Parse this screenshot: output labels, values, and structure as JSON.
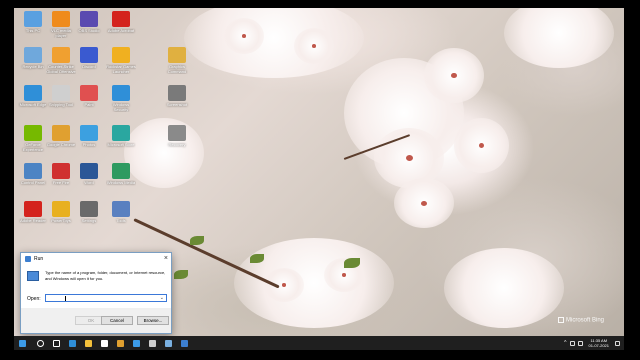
{
  "desktop": {
    "icons": [
      {
        "label": "This PC",
        "color": "#5aa0e0"
      },
      {
        "label": "Recycle Bin",
        "color": "#6fa8dc"
      },
      {
        "label": "Microsoft Edge",
        "color": "#2f8fd8"
      },
      {
        "label": "GeForce Experience",
        "color": "#76b900"
      },
      {
        "label": "Control Panel",
        "color": "#4c84c4"
      },
      {
        "label": "Adobe Reader",
        "color": "#d4231d"
      },
      {
        "label": "VLC media player",
        "color": "#ef8b1c"
      },
      {
        "label": "Counter-Strike Global Offensive",
        "color": "#f0a030"
      },
      {
        "label": "Snipping Tool",
        "color": "#cfcfcf"
      },
      {
        "label": "Google Chrome",
        "color": "#e0a030"
      },
      {
        "label": "Free Fire",
        "color": "#d03030"
      },
      {
        "label": "PowerToys",
        "color": "#e8b020"
      },
      {
        "label": "OBS Studio",
        "color": "#5a4ab0"
      },
      {
        "label": "Discord",
        "color": "#3a5ad0"
      },
      {
        "label": "Paint",
        "color": "#e05050"
      },
      {
        "label": "Photos",
        "color": "#3ca0e0"
      },
      {
        "label": "Word",
        "color": "#2b5797"
      },
      {
        "label": "Settings",
        "color": "#6a6a6a"
      },
      {
        "label": "Adobe Acrobat",
        "color": "#d4231d"
      },
      {
        "label": "Rockstar Games Launcher",
        "color": "#f0b020"
      },
      {
        "label": "Windows Security",
        "color": "#2f8fd8"
      },
      {
        "label": "Microsoft Store",
        "color": "#2aa7a0"
      },
      {
        "label": "Windows Media",
        "color": "#2e9a60"
      },
      {
        "label": "Tools",
        "color": "#5a80c0"
      },
      {
        "label": "Graphics Command",
        "color": "#e0b040"
      },
      {
        "label": "Screenshot",
        "color": "#7a7a7a"
      },
      {
        "label": "Recovery",
        "color": "#8a8a8a"
      }
    ]
  },
  "run_dialog": {
    "title": "Run",
    "description": "Type the name of a program, folder, document, or Internet resource, and Windows will open it for you.",
    "open_label": "Open:",
    "open_value": "",
    "ok_label": "OK",
    "cancel_label": "Cancel",
    "browse_label": "Browse..."
  },
  "taskbar": {
    "items": [
      {
        "name": "start",
        "color": "#3c9be8"
      },
      {
        "name": "search",
        "color": "#ffffff"
      },
      {
        "name": "task-view",
        "color": "#ffffff"
      },
      {
        "name": "edge",
        "color": "#2f8fd8"
      },
      {
        "name": "file-explorer",
        "color": "#f3c03b"
      },
      {
        "name": "store",
        "color": "#ffffff"
      },
      {
        "name": "chrome",
        "color": "#e0a030"
      },
      {
        "name": "app-1",
        "color": "#3c9be8"
      },
      {
        "name": "app-2",
        "color": "#cfcfcf"
      },
      {
        "name": "app-3",
        "color": "#7ab0e0"
      },
      {
        "name": "run",
        "color": "#3d7fd0"
      }
    ],
    "time": "11:35 AM",
    "date": "01-07-2021"
  },
  "watermark": "Microsoft Bing"
}
